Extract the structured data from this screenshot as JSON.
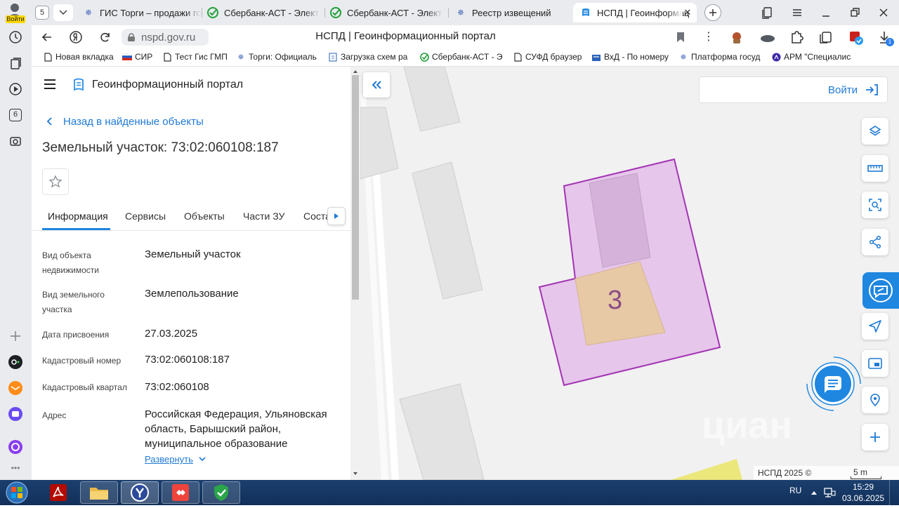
{
  "browser": {
    "profile_label": "Войти",
    "tab_counter": "5",
    "tabs": [
      {
        "title": "ГИС Торги – продажи го"
      },
      {
        "title": "Сбербанк-АСТ - Электр"
      },
      {
        "title": "Сбербанк-АСТ - Электр"
      },
      {
        "title": "Реестр извещений"
      },
      {
        "title": "НСПД | Геоинформац"
      }
    ],
    "address": "nspd.gov.ru",
    "page_title": "НСПД | Геоинформационный портал",
    "bookmarks": [
      {
        "label": "Новая вкладка"
      },
      {
        "label": "СИР"
      },
      {
        "label": "Тест Гис ГМП"
      },
      {
        "label": "Торги: Официаль"
      },
      {
        "label": "Загрузка схем ра"
      },
      {
        "label": "Сбербанк-АСТ - Э"
      },
      {
        "label": "СУФД браузер"
      },
      {
        "label": "ВхД - По номеру"
      },
      {
        "label": "Платформа госуд"
      },
      {
        "label": "АРМ \"Специалис"
      }
    ],
    "sidebar_badge": "6",
    "download_badge": "1"
  },
  "portal": {
    "logo_text": "Геоинформационный портал",
    "back_link": "Назад в найденные объекты",
    "object_title": "Земельный участок: 73:02:060108:187",
    "tabs": [
      "Информация",
      "Сервисы",
      "Объекты",
      "Части ЗУ",
      "Соста"
    ],
    "properties": [
      {
        "label": "Вид объекта недвижимости",
        "value": "Земельный участок"
      },
      {
        "label": "Вид земельного участка",
        "value": "Землепользование"
      },
      {
        "label": "Дата присвоения",
        "value": "27.03.2025"
      },
      {
        "label": "Кадастровый номер",
        "value": "73:02:060108:187"
      },
      {
        "label": "Кадастровый квартал",
        "value": "73:02:060108"
      },
      {
        "label": "Адрес",
        "value": "Российская Федерация, Ульяновская область, Барышский район, муниципальное образование"
      }
    ],
    "expand_link": "Развернуть"
  },
  "map": {
    "login_label": "Войти",
    "building_number": "3",
    "watermark": "циан",
    "copyright": "НСПД 2025 ©",
    "scale_label": "5 m",
    "colors": {
      "parcel_fill": "#e6c6ea",
      "parcel_stroke": "#a334b4",
      "building_fill": "#e8c9a6",
      "accent_blue": "#1f87e0"
    }
  },
  "taskbar": {
    "language": "RU",
    "time": "15:29",
    "date": "03.06.2025"
  }
}
